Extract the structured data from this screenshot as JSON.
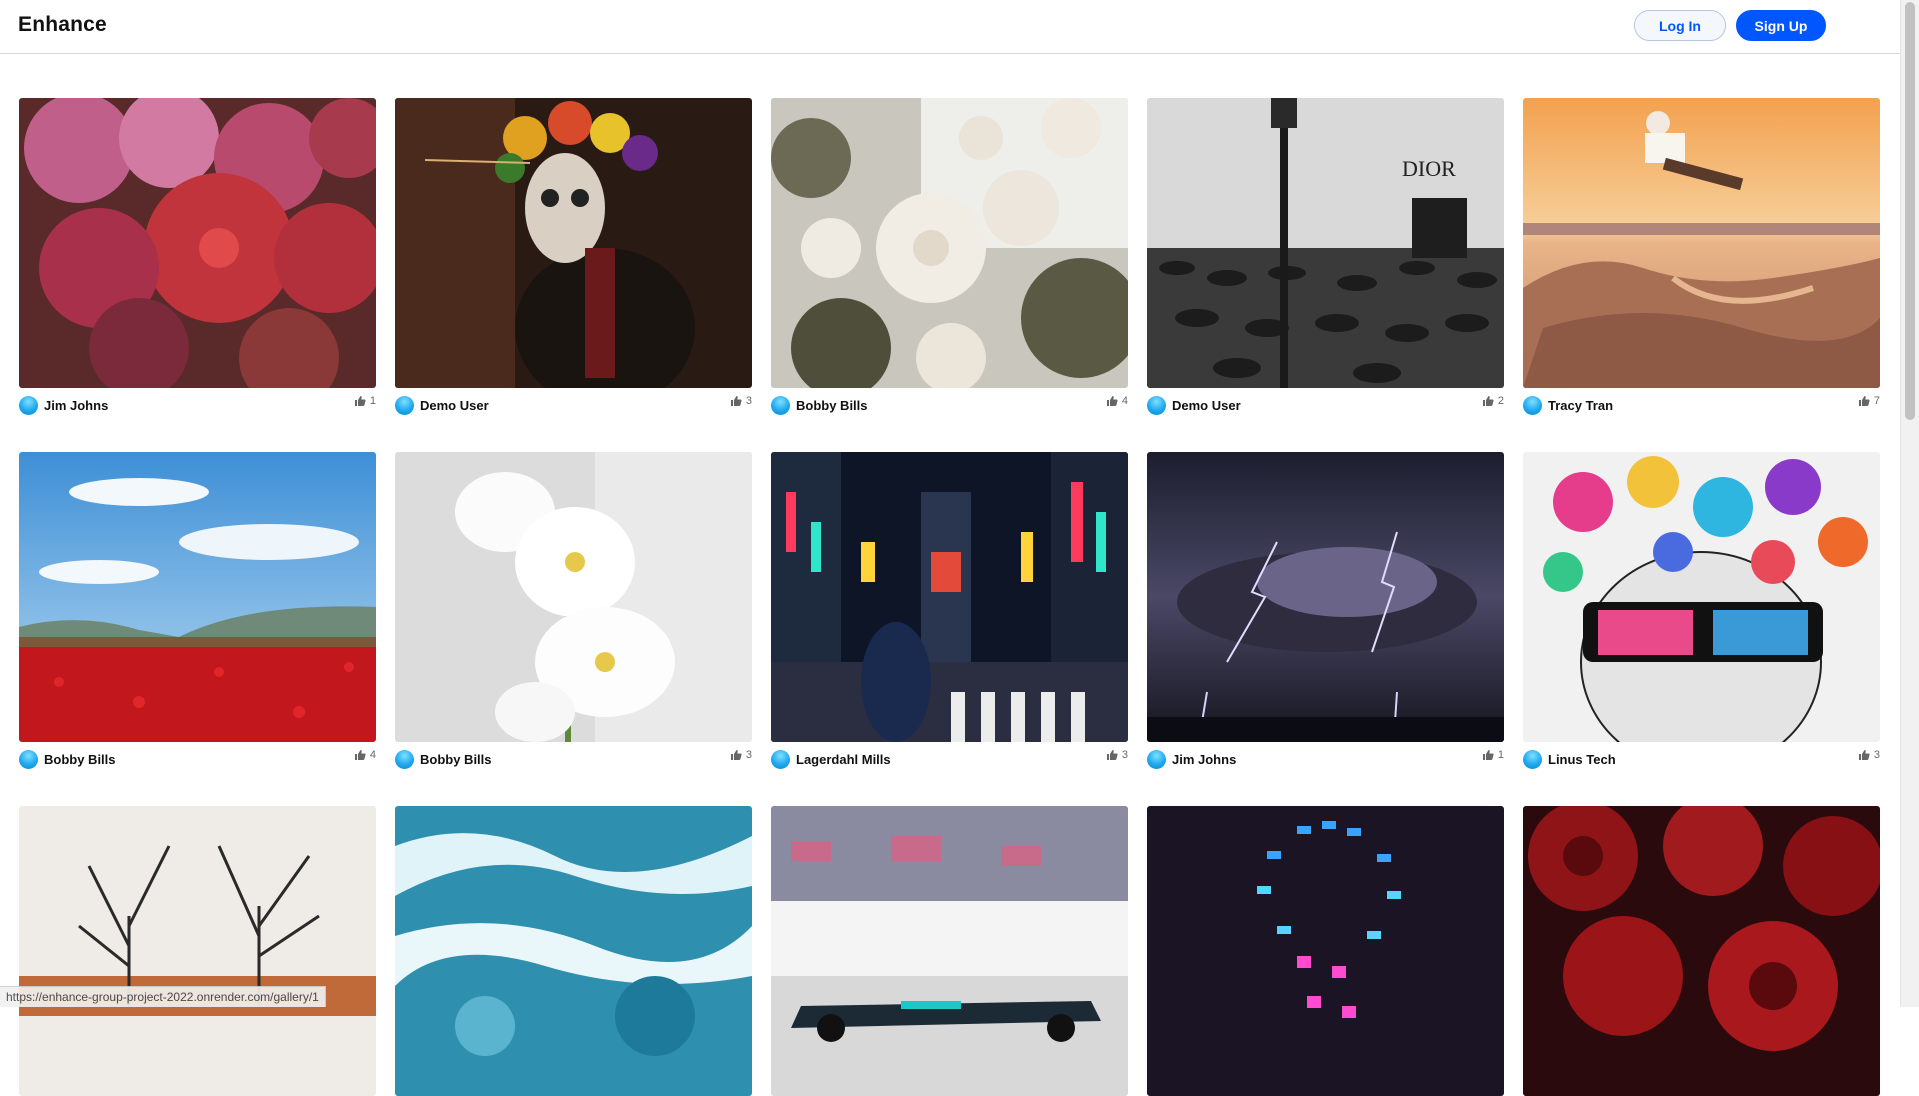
{
  "header": {
    "logo": "Enhance",
    "login_label": "Log In",
    "signup_label": "Sign Up"
  },
  "gallery": [
    {
      "author": "Jim Johns",
      "likes": "1",
      "image": "pink-red-chrysanthemums"
    },
    {
      "author": "Demo User",
      "likes": "3",
      "image": "day-of-the-dead-portrait"
    },
    {
      "author": "Bobby Bills",
      "likes": "4",
      "image": "white-roses"
    },
    {
      "author": "Demo User",
      "likes": "2",
      "image": "dior-crowd-umbrellas-bw"
    },
    {
      "author": "Tracy Tran",
      "likes": "7",
      "image": "skatepark-sunset-skater"
    },
    {
      "author": "Bobby Bills",
      "likes": "4",
      "image": "red-poppy-field"
    },
    {
      "author": "Bobby Bills",
      "likes": "3",
      "image": "white-orchid"
    },
    {
      "author": "Lagerdahl Mills",
      "likes": "3",
      "image": "tokyo-night-street"
    },
    {
      "author": "Jim Johns",
      "likes": "1",
      "image": "lightning-storm-sea"
    },
    {
      "author": "Linus Tech",
      "likes": "3",
      "image": "colorful-paint-head-illustration"
    },
    {
      "image": "bare-trees-autumn"
    },
    {
      "image": "ocean-waves-aerial"
    },
    {
      "image": "formula-one-car"
    },
    {
      "image": "neon-spiral-night"
    },
    {
      "image": "red-roses"
    }
  ],
  "statusbar": {
    "url": "https://enhance-group-project-2022.onrender.com/gallery/1"
  }
}
